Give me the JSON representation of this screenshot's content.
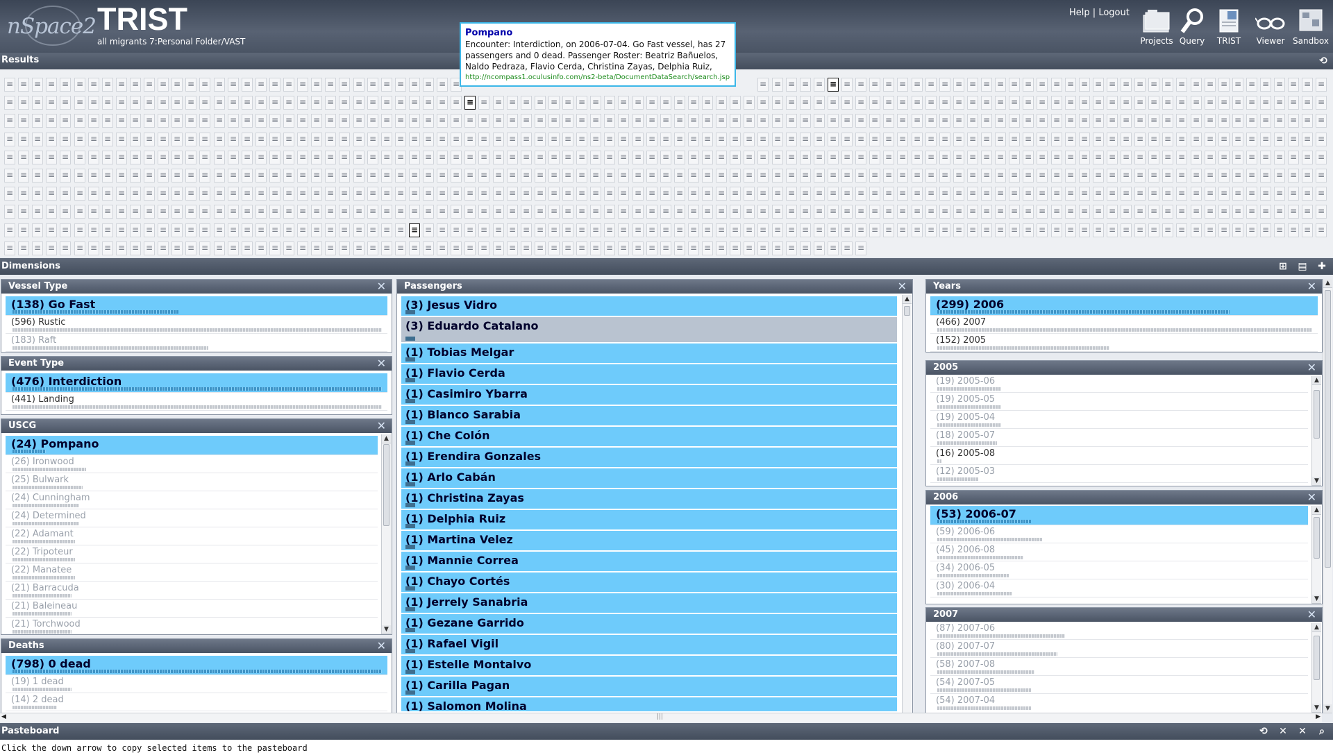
{
  "header": {
    "logo_text": "nSpace2",
    "title": "TRIST",
    "path": "all migrants 7:Personal Folder/VAST",
    "help": "Help",
    "sep": "|",
    "logout": "Logout",
    "tools": [
      {
        "label": "Projects",
        "icon": "folder-stack-icon"
      },
      {
        "label": "Query",
        "icon": "magnifier-icon"
      },
      {
        "label": "TRIST",
        "icon": "trist-doc-icon"
      },
      {
        "label": "Viewer",
        "icon": "glasses-icon"
      },
      {
        "label": "Sandbox",
        "icon": "sandbox-icon"
      }
    ]
  },
  "results": {
    "label": "Results",
    "icon_glyph": "≡",
    "tooltip": {
      "title": "Pompano",
      "body": "Encounter: Interdiction, on 2006-07-04. Go Fast vessel, has 27 passengers and 0 dead. Passenger Roster: Beatriz Bañuelos, Naldo Pedraza, Flavio Cerda, Christina Zayas, Delphia Ruiz,",
      "url": "http://ncompass1.oculusinfo.com/ns2-beta/DocumentDataSearch/search.jsp?pro"
    }
  },
  "dimensions": {
    "label": "Dimensions"
  },
  "panels": {
    "vessel_type": {
      "title": "Vessel Type",
      "items": [
        {
          "label": "(138) Go Fast",
          "state": "sel",
          "level": 0.45
        },
        {
          "label": "(596) Rustic",
          "state": "normal",
          "level": 1.0
        },
        {
          "label": "(183) Raft",
          "state": "dim",
          "level": 0.53
        }
      ]
    },
    "event_type": {
      "title": "Event Type",
      "items": [
        {
          "label": "(476) Interdiction",
          "state": "sel",
          "level": 1.0
        },
        {
          "label": "(441) Landing",
          "state": "normal",
          "level": 1.0
        }
      ]
    },
    "uscg": {
      "title": "USCG",
      "items": [
        {
          "label": "(24) Pompano",
          "state": "sel",
          "level": 0.09
        },
        {
          "label": "(26) Ironwood",
          "state": "dim",
          "level": 0.2
        },
        {
          "label": "(25) Bulwark",
          "state": "dim",
          "level": 0.19
        },
        {
          "label": "(24) Cunningham",
          "state": "dim",
          "level": 0.18
        },
        {
          "label": "(24) Determined",
          "state": "dim",
          "level": 0.18
        },
        {
          "label": "(22) Adamant",
          "state": "dim",
          "level": 0.17
        },
        {
          "label": "(22) Tripoteur",
          "state": "dim",
          "level": 0.17
        },
        {
          "label": "(22) Manatee",
          "state": "dim",
          "level": 0.17
        },
        {
          "label": "(21) Barracuda",
          "state": "dim",
          "level": 0.16
        },
        {
          "label": "(21) Baleineau",
          "state": "dim",
          "level": 0.16
        },
        {
          "label": "(21) Torchwood",
          "state": "dim",
          "level": 0.16
        }
      ]
    },
    "deaths": {
      "title": "Deaths",
      "items": [
        {
          "label": "(798) 0 dead",
          "state": "sel",
          "level": 1.0
        },
        {
          "label": "(19) 1 dead",
          "state": "dim",
          "level": 0.16
        },
        {
          "label": "(14) 2 dead",
          "state": "dim",
          "level": 0.12
        }
      ]
    },
    "passengers": {
      "title": "Passengers",
      "items": [
        {
          "label": "(3) Jesus Vidro",
          "state": "sel"
        },
        {
          "label": "(3) Eduardo Catalano",
          "state": "focus"
        },
        {
          "label": "(1) Tobias Melgar",
          "state": "sel"
        },
        {
          "label": "(1) Flavio Cerda",
          "state": "sel"
        },
        {
          "label": "(1) Casimiro Ybarra",
          "state": "sel"
        },
        {
          "label": "(1) Blanco Sarabia",
          "state": "sel"
        },
        {
          "label": "(1) Che Colón",
          "state": "sel"
        },
        {
          "label": "(1) Erendira Gonzales",
          "state": "sel"
        },
        {
          "label": "(1) Arlo Cabán",
          "state": "sel"
        },
        {
          "label": "(1) Christina Zayas",
          "state": "sel"
        },
        {
          "label": "(1) Delphia Ruiz",
          "state": "sel"
        },
        {
          "label": "(1) Martina Velez",
          "state": "sel"
        },
        {
          "label": "(1) Mannie Correa",
          "state": "sel"
        },
        {
          "label": "(1) Chayo Cortés",
          "state": "sel"
        },
        {
          "label": "(1) Jerrely Sanabria",
          "state": "sel"
        },
        {
          "label": "(1) Gezane Garrido",
          "state": "sel"
        },
        {
          "label": "(1) Rafael Vigil",
          "state": "sel"
        },
        {
          "label": "(1) Estelle Montalvo",
          "state": "sel"
        },
        {
          "label": "(1) Carilla Pagan",
          "state": "sel"
        },
        {
          "label": "(1) Salomon Molina",
          "state": "sel"
        }
      ]
    },
    "years": {
      "title": "Years",
      "items": [
        {
          "label": "(299) 2006",
          "state": "sel",
          "level": 0.78
        },
        {
          "label": "(466) 2007",
          "state": "normal",
          "level": 1.0
        },
        {
          "label": "(152) 2005",
          "state": "normal",
          "level": 0.46
        }
      ]
    },
    "y2005": {
      "title": "2005",
      "items": [
        {
          "label": "(19) 2005-06",
          "state": "dim",
          "level": 0.17
        },
        {
          "label": "(19) 2005-05",
          "state": "dim",
          "level": 0.17
        },
        {
          "label": "(19) 2005-04",
          "state": "dim",
          "level": 0.17
        },
        {
          "label": "(18) 2005-07",
          "state": "dim",
          "level": 0.16
        },
        {
          "label": "(16) 2005-08",
          "state": "normal",
          "level": 0.0
        },
        {
          "label": "(12) 2005-03",
          "state": "dim",
          "level": 0.11
        }
      ]
    },
    "y2006": {
      "title": "2006",
      "items": [
        {
          "label": "(53) 2006-07",
          "state": "sel",
          "level": 0.25
        },
        {
          "label": "(59) 2006-06",
          "state": "dim",
          "level": 0.28
        },
        {
          "label": "(45) 2006-08",
          "state": "dim",
          "level": 0.23
        },
        {
          "label": "(34) 2006-05",
          "state": "dim",
          "level": 0.19
        },
        {
          "label": "(30) 2006-04",
          "state": "dim",
          "level": 0.2
        }
      ]
    },
    "y2007": {
      "title": "2007",
      "items": [
        {
          "label": "(87) 2007-06",
          "state": "dim",
          "level": 0.34
        },
        {
          "label": "(80) 2007-07",
          "state": "dim",
          "level": 0.32
        },
        {
          "label": "(58) 2007-08",
          "state": "dim",
          "level": 0.26
        },
        {
          "label": "(54) 2007-05",
          "state": "dim",
          "level": 0.25
        },
        {
          "label": "(54) 2007-04",
          "state": "dim",
          "level": 0.25
        }
      ]
    }
  },
  "pasteboard": {
    "label": "Pasteboard"
  },
  "status": {
    "text": "Click the down arrow to copy selected items to the pasteboard"
  },
  "colors": {
    "selected": "#6ecbfb",
    "focus": "#b9c3d0",
    "header": "#4a5464",
    "tooltip_border": "#3cb7e8"
  }
}
